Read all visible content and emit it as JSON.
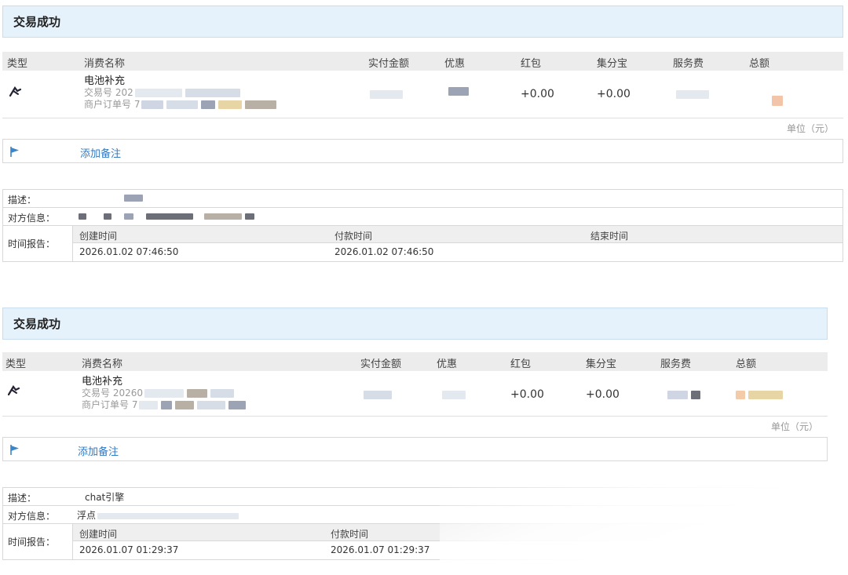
{
  "records": [
    {
      "status": "交易成功",
      "headers": [
        "类型",
        "消费名称",
        "实付金额",
        "优惠",
        "红包",
        "集分宝",
        "服务费",
        "总额"
      ],
      "item": {
        "name": "电池补充",
        "trade_no_label": "交易号 202",
        "order_no_label": "商户订单号 7",
        "red_packet": "+0.00",
        "points": "+0.00"
      },
      "unit": "单位（元）",
      "add_remark": "添加备注",
      "desc_label": "描述：",
      "desc_value": "",
      "counterparty_label": "对方信息：",
      "time_label": "时间报告：",
      "time_headers": [
        "创建时间",
        "付款时间",
        "结束时间"
      ],
      "time_values": [
        "2026.01.02 07:46:50",
        "2026.01.02 07:46:50",
        ""
      ]
    },
    {
      "status": "交易成功",
      "headers": [
        "类型",
        "消费名称",
        "实付金额",
        "优惠",
        "红包",
        "集分宝",
        "服务费",
        "总额"
      ],
      "item": {
        "name": "电池补充",
        "trade_no_label": "交易号 20260",
        "order_no_label": "商户订单号 7",
        "red_packet": "+0.00",
        "points": "+0.00"
      },
      "unit": "单位（元）",
      "add_remark": "添加备注",
      "desc_label": "描述：",
      "desc_value": "chat引擎",
      "counterparty_label": "对方信息：",
      "counterparty_value": "浮点",
      "time_label": "时间报告：",
      "time_headers": [
        "创建时间",
        "付款时间"
      ],
      "time_values": [
        "2026.01.07 01:29:37",
        "2026.01.07 01:29:37"
      ]
    }
  ],
  "colors": {
    "status_bg": "#e6f2fb",
    "link": "#2f7bc4",
    "header_bg": "#ececec"
  }
}
